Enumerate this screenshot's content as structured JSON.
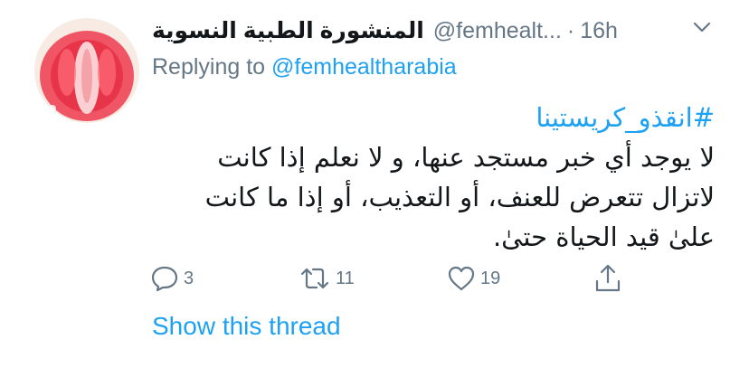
{
  "tweet": {
    "display_name": "المنشورة الطبية النسوية",
    "handle": "@femhealt...",
    "separator": "·",
    "time": "16h",
    "replying_to_label": "Replying to",
    "replying_to_handle": "@femhealtharabia",
    "hashtag": "#انقذو_كريستينا",
    "text_lines": [
      "لا يوجد أي خبر مستجد عنها، و لا نعلم إذا كانت",
      "لاتزال تتعرض للعنف، أو التعذيب، أو إذا ما كانت",
      "علىٰ قيد الحياة حتىٰ."
    ]
  },
  "actions": {
    "reply_count": "3",
    "retweet_count": "11",
    "like_count": "19"
  },
  "show_thread_label": "Show this thread",
  "colors": {
    "accent": "#1da1f2",
    "secondary_text": "#657786",
    "primary_text": "#14171a"
  },
  "icons": [
    "avatar-image",
    "chevron-down-icon",
    "reply-icon",
    "retweet-icon",
    "like-icon",
    "share-icon"
  ]
}
